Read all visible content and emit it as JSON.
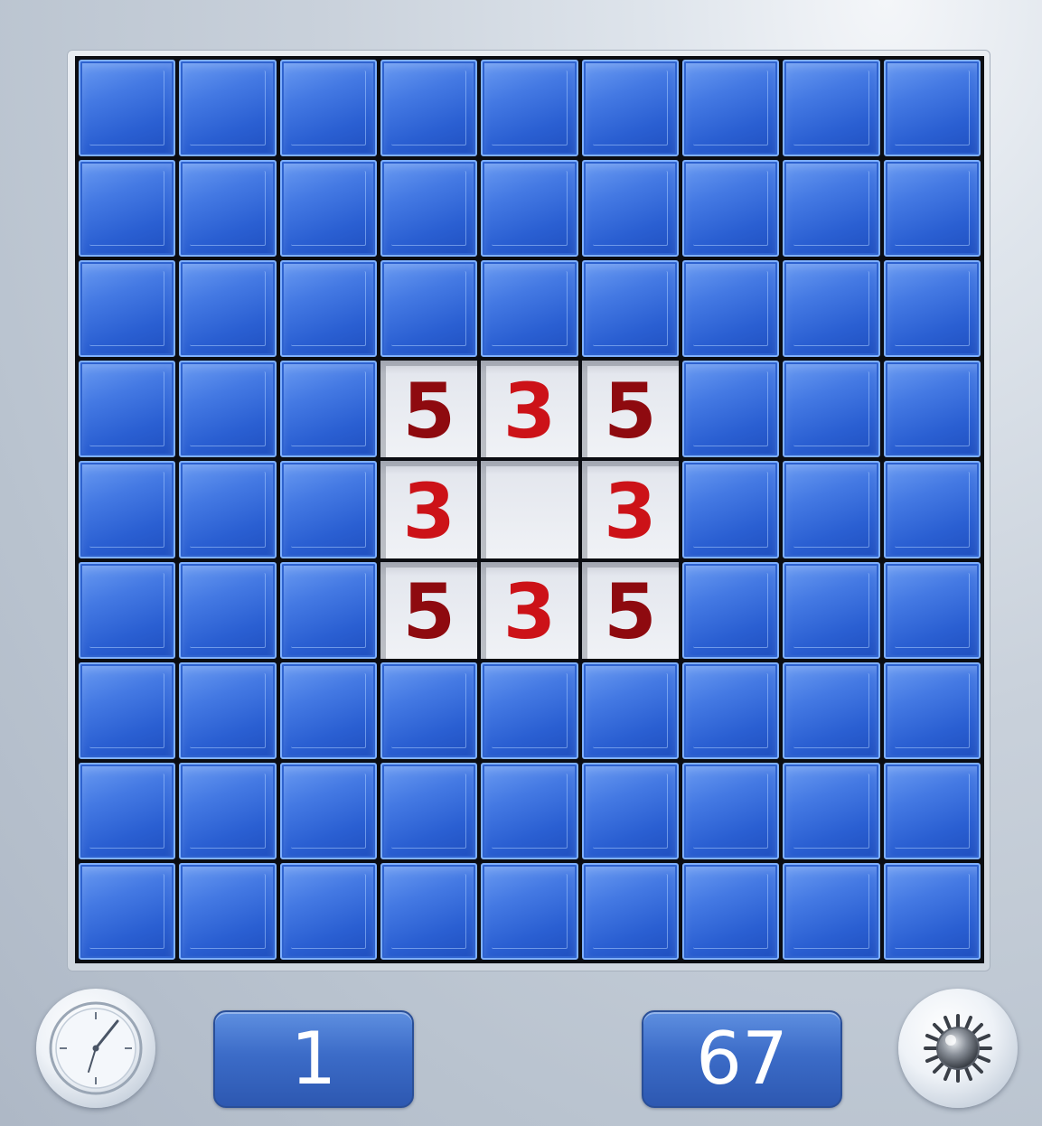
{
  "game": {
    "rows": 9,
    "cols": 9,
    "board": [
      [
        "C",
        "C",
        "C",
        "C",
        "C",
        "C",
        "C",
        "C",
        "C"
      ],
      [
        "C",
        "C",
        "C",
        "C",
        "C",
        "C",
        "C",
        "C",
        "C"
      ],
      [
        "C",
        "C",
        "C",
        "C",
        "C",
        "C",
        "C",
        "C",
        "C"
      ],
      [
        "C",
        "C",
        "C",
        "5",
        "3",
        "5",
        "C",
        "C",
        "C"
      ],
      [
        "C",
        "C",
        "C",
        "3",
        "",
        "3",
        "C",
        "C",
        "C"
      ],
      [
        "C",
        "C",
        "C",
        "5",
        "3",
        "5",
        "C",
        "C",
        "C"
      ],
      [
        "C",
        "C",
        "C",
        "C",
        "C",
        "C",
        "C",
        "C",
        "C"
      ],
      [
        "C",
        "C",
        "C",
        "C",
        "C",
        "C",
        "C",
        "C",
        "C"
      ],
      [
        "C",
        "C",
        "C",
        "C",
        "C",
        "C",
        "C",
        "C",
        "C"
      ]
    ]
  },
  "status": {
    "time": "1",
    "mines_left": "67",
    "time_icon": "stopwatch-icon",
    "mines_icon": "mine-icon"
  },
  "colors": {
    "tile_blue": "#2a5fd2",
    "number_3": "#cc1218",
    "number_5": "#8e0a0f"
  }
}
